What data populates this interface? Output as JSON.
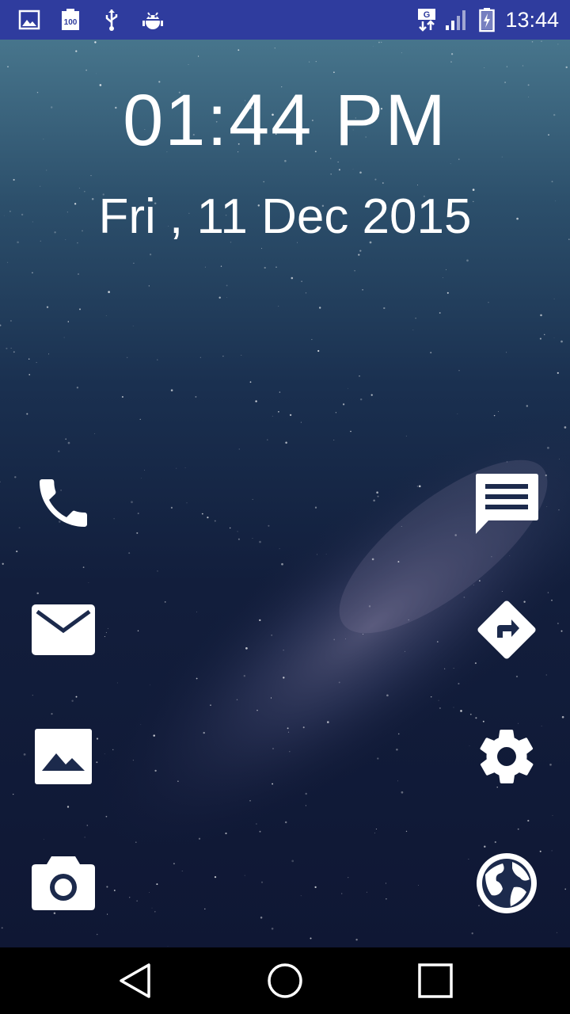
{
  "status_bar": {
    "left_icons": [
      "gallery-icon",
      "battery-100-icon",
      "usb-icon",
      "android-debug-icon"
    ],
    "right_icons": [
      "network-g-icon",
      "signal-icon",
      "battery-charging-icon"
    ],
    "time": "13:44"
  },
  "lockscreen": {
    "clock": "01:44 PM",
    "date": "Fri , 11 Dec 2015"
  },
  "shortcuts": {
    "left": [
      "phone-icon",
      "email-icon",
      "gallery-icon",
      "camera-icon"
    ],
    "right": [
      "message-icon",
      "directions-icon",
      "settings-icon",
      "browser-globe-icon"
    ]
  },
  "nav_bar": {
    "buttons": [
      "back-icon",
      "home-icon",
      "recents-icon"
    ]
  },
  "colors": {
    "status_bar": "#2f3c9e",
    "nav_bar": "#000000",
    "text": "#ffffff"
  }
}
